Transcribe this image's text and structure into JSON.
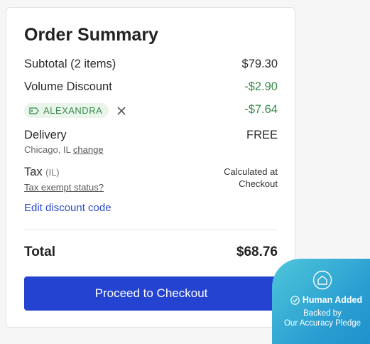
{
  "summary": {
    "title": "Order Summary",
    "subtotal": {
      "label": "Subtotal (2 items)",
      "value": "$79.30"
    },
    "volume_discount": {
      "label": "Volume Discount",
      "value": "-$2.90"
    },
    "coupon": {
      "code": "ALEXANDRA",
      "value": "-$7.64",
      "icon": "tag-icon",
      "remove_icon": "close-icon"
    },
    "delivery": {
      "label": "Delivery",
      "value": "FREE",
      "location": "Chicago, IL",
      "change_link": "change"
    },
    "tax": {
      "label": "Tax",
      "region": "(IL)",
      "exempt_link": "Tax exempt status?",
      "note_line1": "Calculated at",
      "note_line2": "Checkout"
    },
    "edit_discount_link": "Edit discount code",
    "total": {
      "label": "Total",
      "value": "$68.76"
    },
    "checkout_button": "Proceed to Checkout"
  },
  "badge": {
    "icon": "home-shield-icon",
    "heading": "Human Added",
    "line1": "Backed by",
    "line2": "Our Accuracy Pledge"
  },
  "colors": {
    "accent": "#2443d0",
    "discount_green": "#3a8a4c",
    "link_blue": "#2c4cc8",
    "badge_teal": "#4fc6da"
  }
}
